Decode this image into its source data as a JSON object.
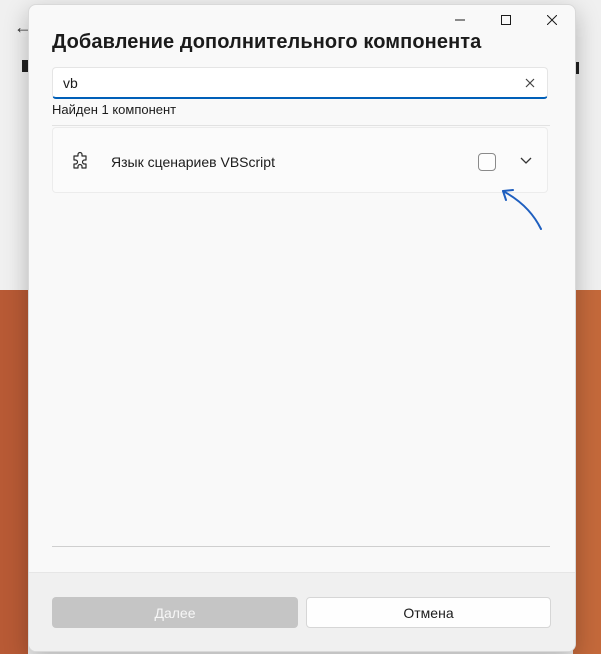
{
  "dialog": {
    "title": "Добавление дополнительного компонента"
  },
  "search": {
    "value": "vb",
    "clear_icon": "close-icon"
  },
  "results": {
    "count_text": "Найден 1 компонент",
    "items": [
      {
        "label": "Язык сценариев VBScript",
        "icon": "puzzle-icon",
        "checked": false
      }
    ]
  },
  "footer": {
    "next_label": "Далее",
    "cancel_label": "Отмена"
  },
  "colors": {
    "accent": "#005fb8",
    "annotation_arrow": "#1f5fbf",
    "disabled_button": "#c5c5c5"
  }
}
